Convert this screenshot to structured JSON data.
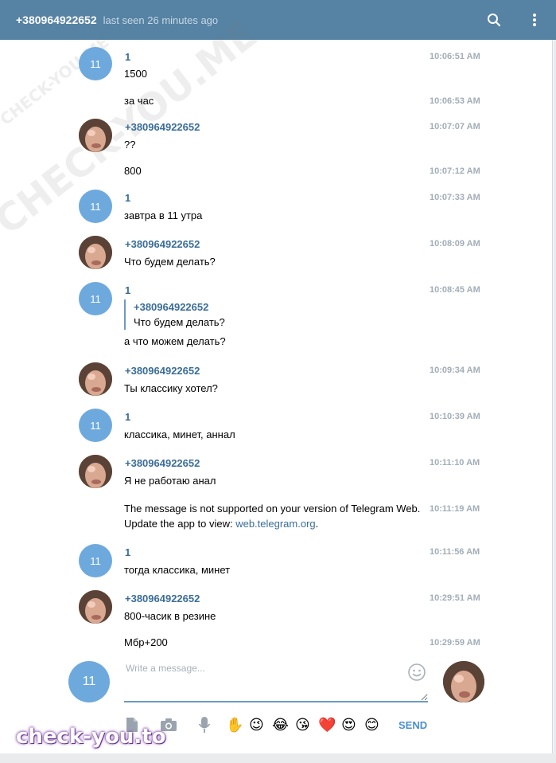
{
  "header": {
    "peer_name": "+380964922652",
    "peer_status": "last seen 26 minutes ago",
    "search_icon": "search-icon",
    "menu_icon": "more-vertical-icon"
  },
  "messages": [
    {
      "author": "1",
      "avatar": "11",
      "text": "1500",
      "time": "10:06:51 AM"
    },
    {
      "text": "за час",
      "time": "10:06:53 AM"
    },
    {
      "author": "+380964922652",
      "avatar": "photo",
      "text": "??",
      "time": "10:07:07 AM"
    },
    {
      "text": "800",
      "time": "10:07:12 AM"
    },
    {
      "author": "1",
      "avatar": "11",
      "text": "завтра в 11 утра",
      "time": "10:07:33 AM"
    },
    {
      "author": "+380964922652",
      "avatar": "photo",
      "text": "Что будем делать?",
      "time": "10:08:09 AM"
    },
    {
      "author": "1",
      "avatar": "11",
      "quote_author": "+380964922652",
      "quote_text": "Что будем делать?",
      "text": "а что можем делать?",
      "time": "10:08:45 AM"
    },
    {
      "author": "+380964922652",
      "avatar": "photo",
      "text": "Ты классику хотел?",
      "time": "10:09:34 AM"
    },
    {
      "author": "1",
      "avatar": "11",
      "text": "классика, минет, аннал",
      "time": "10:10:39 AM"
    },
    {
      "author": "+380964922652",
      "avatar": "photo",
      "text": "Я не работаю анал",
      "time": "10:11:10 AM"
    },
    {
      "text_line1": "The message is not supported on your version of Telegram Web.",
      "text_line2_prefix": "Update the app to view: ",
      "link": "web.telegram.org",
      "text_line2_suffix": ".",
      "time": "10:11:19 AM"
    },
    {
      "author": "1",
      "avatar": "11",
      "text": "тогда классика, минет",
      "time": "10:11:56 AM"
    },
    {
      "author": "+380964922652",
      "avatar": "photo",
      "text": "800-часик в резине",
      "time": "10:29:51 AM"
    },
    {
      "text": "Мбр+200",
      "time": "10:29:59 AM"
    }
  ],
  "composer": {
    "avatar_label": "11",
    "placeholder": "Write a message...",
    "value": "",
    "send_label": "SEND",
    "emojis": [
      "✋",
      "😉",
      "😂",
      "😘",
      "❤️",
      "😍",
      "😊"
    ]
  },
  "watermarks": {
    "main": "CHECK-YOU.ME",
    "small": "CHECK-YOU.ME",
    "bottom": "check-you.to"
  },
  "colors": {
    "header_bg": "#5682a3",
    "author": "#3a6d99",
    "avatar_bg": "#6ea9de",
    "send": "#4a8fd1"
  }
}
